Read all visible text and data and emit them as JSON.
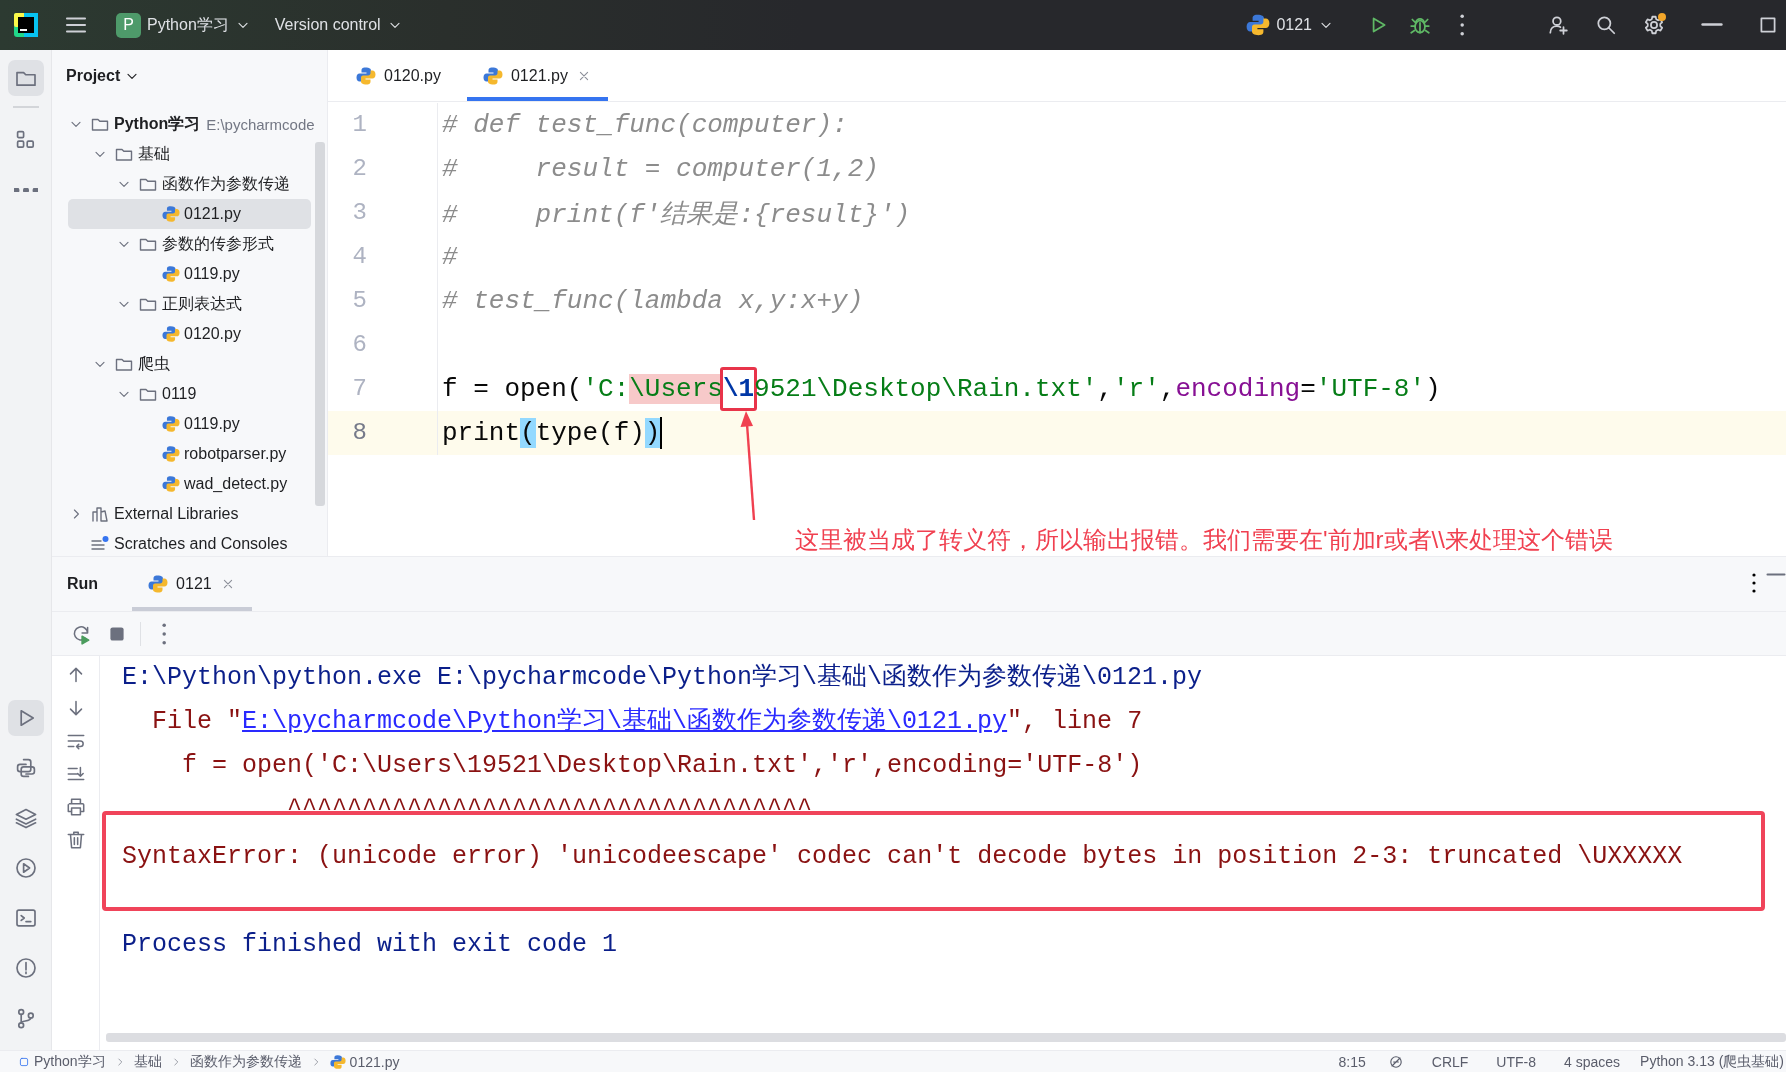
{
  "title_bar": {
    "project_badge": "P",
    "project": "Python学习",
    "vcs": "Version control",
    "run_config": "0121"
  },
  "project_panel": {
    "title": "Project",
    "tree": [
      {
        "label": "Python学习",
        "path": "E:\\pycharmcode",
        "kind": "project",
        "expanded": true,
        "selected": false,
        "children": [
          {
            "label": "基础",
            "kind": "folder",
            "expanded": true,
            "selected": false,
            "children": [
              {
                "label": "函数作为参数传递",
                "kind": "folder",
                "expanded": true,
                "selected": false,
                "children": [
                  {
                    "label": "0121.py",
                    "kind": "python",
                    "selected": true
                  }
                ]
              },
              {
                "label": "参数的传参形式",
                "kind": "folder",
                "expanded": true,
                "selected": false,
                "children": [
                  {
                    "label": "0119.py",
                    "kind": "python",
                    "selected": false
                  }
                ]
              },
              {
                "label": "正则表达式",
                "kind": "folder",
                "expanded": true,
                "selected": false,
                "children": [
                  {
                    "label": "0120.py",
                    "kind": "python",
                    "selected": false
                  }
                ]
              }
            ]
          },
          {
            "label": "爬虫",
            "kind": "folder",
            "expanded": true,
            "selected": false,
            "children": [
              {
                "label": "0119",
                "kind": "folder",
                "expanded": true,
                "selected": false,
                "children": [
                  {
                    "label": "0119.py",
                    "kind": "python",
                    "selected": false
                  },
                  {
                    "label": "robotparser.py",
                    "kind": "python",
                    "selected": false
                  },
                  {
                    "label": "wad_detect.py",
                    "kind": "python",
                    "selected": false
                  }
                ]
              }
            ]
          }
        ]
      },
      {
        "label": "External Libraries",
        "kind": "libraries",
        "expanded": false,
        "selected": false
      },
      {
        "label": "Scratches and Consoles",
        "kind": "scratches",
        "selected": false
      }
    ]
  },
  "editor": {
    "tabs": [
      {
        "label": "0120.py",
        "selected": false
      },
      {
        "label": "0121.py",
        "selected": true
      }
    ],
    "lines": [
      {
        "number": "1",
        "current": false,
        "tokens": [
          {
            "kind": "comment",
            "text": "# def test_func(computer):"
          }
        ]
      },
      {
        "number": "2",
        "current": false,
        "tokens": [
          {
            "kind": "comment",
            "text": "#     result = computer(1,2)"
          }
        ]
      },
      {
        "number": "3",
        "current": false,
        "tokens": [
          {
            "kind": "comment",
            "text": "#     print(f'结果是:{result}')"
          }
        ]
      },
      {
        "number": "4",
        "current": false,
        "tokens": [
          {
            "kind": "comment",
            "text": "#"
          }
        ]
      },
      {
        "number": "5",
        "current": false,
        "tokens": [
          {
            "kind": "comment",
            "text": "# test_func(lambda x,y:x+y)"
          }
        ]
      },
      {
        "number": "6",
        "current": false
      },
      {
        "number": "7",
        "current": false,
        "tokens": [
          {
            "kind": "plain",
            "text": "f = open("
          },
          {
            "kind": "string",
            "text": "'C:"
          },
          {
            "kind": "string-highlight",
            "text": "\\Users"
          },
          {
            "kind": "escape",
            "text": "\\1",
            "marked": true
          },
          {
            "kind": "string",
            "text": "9521\\Desktop\\Rain.txt'"
          },
          {
            "kind": "plain",
            "text": ","
          },
          {
            "kind": "string",
            "text": "'r'"
          },
          {
            "kind": "plain",
            "text": ","
          },
          {
            "kind": "keyword-arg",
            "text": "encoding"
          },
          {
            "kind": "plain",
            "text": "="
          },
          {
            "kind": "string",
            "text": "'UTF-8'"
          },
          {
            "kind": "plain",
            "text": ")"
          }
        ]
      },
      {
        "number": "8",
        "current": true,
        "tokens": [
          {
            "kind": "plain",
            "text": "print"
          },
          {
            "kind": "bracket-match",
            "text": "("
          },
          {
            "kind": "plain",
            "text": "type(f)"
          },
          {
            "kind": "bracket-match",
            "text": ")"
          }
        ]
      }
    ],
    "annotation": "这里被当成了转义符，所以输出报错。我们需要在'前加r或者\\\\来处理这个错误"
  },
  "run_panel": {
    "title": "Run",
    "tabs": [
      {
        "label": "0121",
        "selected": true
      }
    ],
    "output": [
      {
        "kind": "command",
        "segments": [
          {
            "kind": "plain",
            "text": "E:\\Python\\python.exe E:\\pycharmcode\\Python学习\\基础\\函数作为参数传递\\0121.py"
          }
        ]
      },
      {
        "kind": "trace",
        "segments": [
          {
            "kind": "plain",
            "text": "  File \""
          },
          {
            "kind": "link",
            "text": "E:\\pycharmcode\\Python学习\\基础\\函数作为参数传递\\0121.py"
          },
          {
            "kind": "plain",
            "text": "\", line 7"
          }
        ]
      },
      {
        "kind": "trace",
        "segments": [
          {
            "kind": "plain",
            "text": "    f = open('C:\\Users\\19521\\Desktop\\Rain.txt','r',encoding='UTF-8')"
          }
        ]
      },
      {
        "kind": "trace",
        "segments": [
          {
            "kind": "plain",
            "text": "           ^^^^^^^^^^^^^^^^^^^^^^^^^^^^^^^^^^^"
          }
        ]
      },
      {
        "kind": "error",
        "segments": [
          {
            "kind": "plain",
            "text": "SyntaxError: (unicode error) 'unicodeescape' codec can't decode bytes in position 2-3: truncated \\UXXXXX"
          }
        ]
      },
      {
        "kind": "exit",
        "segments": [
          {
            "kind": "plain",
            "text": "Process finished with exit code 1"
          }
        ]
      }
    ]
  },
  "status_bar": {
    "breadcrumbs": [
      {
        "label": "Python学习",
        "kind": "module"
      },
      {
        "label": "基础",
        "kind": "folder"
      },
      {
        "label": "函数作为参数传递",
        "kind": "folder"
      },
      {
        "label": "0121.py",
        "kind": "python"
      }
    ],
    "position": "8:15",
    "line_ending": "CRLF",
    "encoding": "UTF-8",
    "indent": "4 spaces",
    "interpreter": "Python 3.13 (爬虫基础)"
  }
}
